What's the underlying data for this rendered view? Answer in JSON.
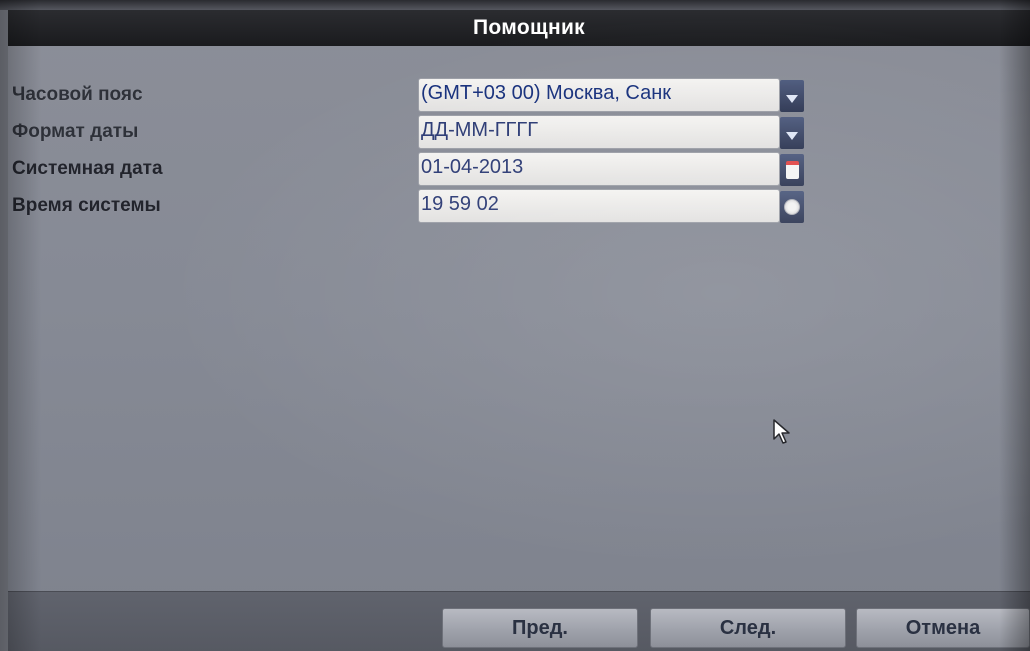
{
  "dialog": {
    "title": "Помощник"
  },
  "fields": [
    {
      "label": "Часовой пояс",
      "value": "(GMT+03 00) Москва, Санк",
      "control": "dropdown"
    },
    {
      "label": "Формат даты",
      "value": "ДД-ММ-ГГГГ",
      "control": "dropdown"
    },
    {
      "label": "Системная дата",
      "value": "01-04-2013",
      "control": "calendar"
    },
    {
      "label": "Время системы",
      "value": "19 59 02",
      "control": "clock"
    }
  ],
  "buttons": {
    "prev": "Пред.",
    "next": "След.",
    "cancel": "Отмена"
  },
  "icons": {
    "dropdown": "chevron-down-icon",
    "calendar": "calendar-icon",
    "clock": "clock-icon",
    "cursor": "mouse-pointer-icon"
  },
  "colors": {
    "title_bar": "#1f2023",
    "panel": "#868a95",
    "field_bg": "#efeeec",
    "field_text": "#2b3a74",
    "side_button": "#3a4562",
    "button": "#a3a6af"
  }
}
